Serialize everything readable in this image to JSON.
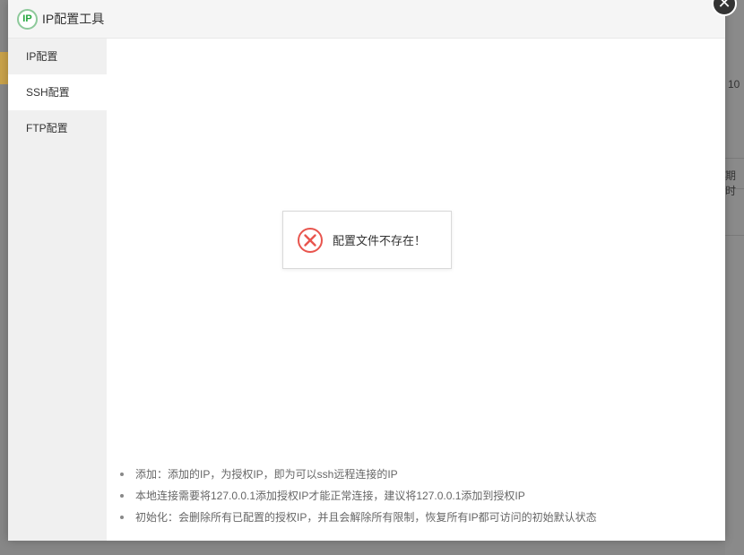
{
  "dialog": {
    "title": "IP配置工具",
    "logo_text": "IP",
    "close_glyph": "✕"
  },
  "sidebar": {
    "items": [
      {
        "label": "IP配置"
      },
      {
        "label": "SSH配置"
      },
      {
        "label": "FTP配置"
      }
    ],
    "active_index": 1
  },
  "toast": {
    "message": "配置文件不存在！",
    "icon": "error-circle-icon",
    "icon_color": "#e8554e"
  },
  "tips": [
    "添加：添加的IP，为授权IP，即为可以ssh远程连接的IP",
    "本地连接需要将127.0.0.1添加授权IP才能正常连接，建议将127.0.0.1添加到授权IP",
    "初始化：会删除所有已配置的授权IP，并且会解除所有限制，恢复所有IP都可访问的初始默认状态"
  ],
  "background": {
    "hint_right_1": "10",
    "hint_right_2": "期时"
  },
  "colors": {
    "overlay": "#878787",
    "brand_green": "#20a53a"
  }
}
